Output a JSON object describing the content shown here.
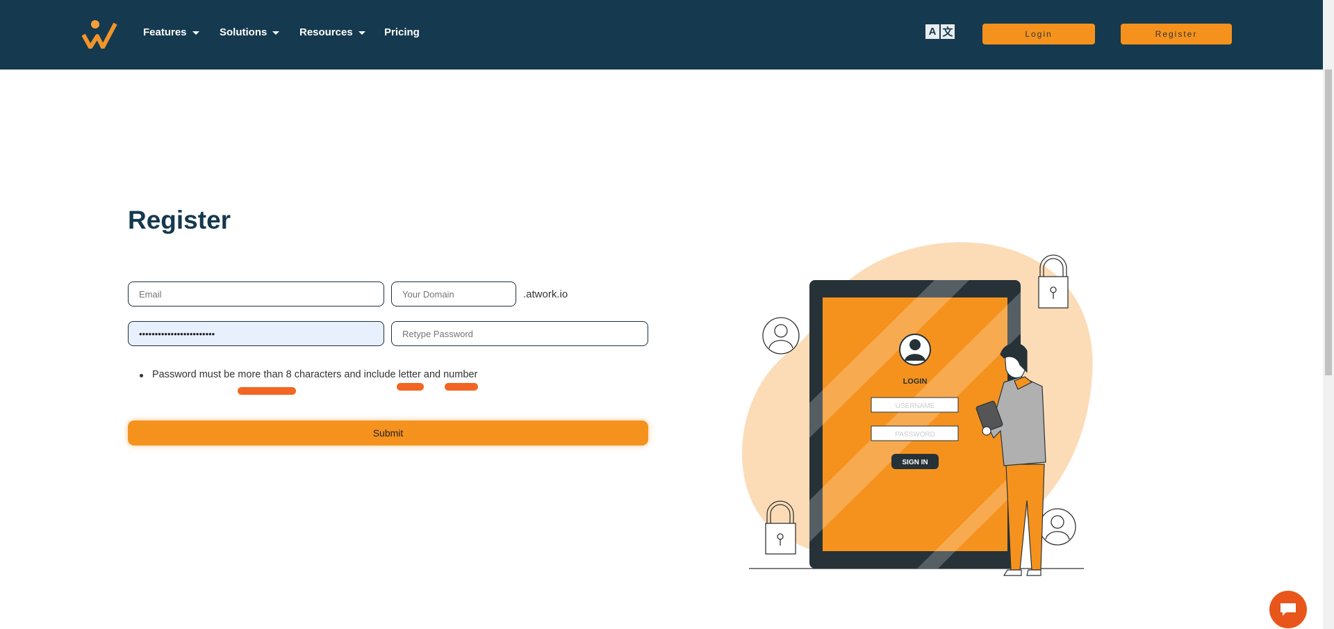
{
  "header": {
    "nav": [
      {
        "label": "Features",
        "has_dropdown": true
      },
      {
        "label": "Solutions",
        "has_dropdown": true
      },
      {
        "label": "Resources",
        "has_dropdown": true
      },
      {
        "label": "Pricing",
        "has_dropdown": false
      }
    ],
    "translate_icon": {
      "left": "A",
      "right": "文"
    },
    "login_label": "Login",
    "register_label": "Register"
  },
  "form": {
    "title": "Register",
    "email_placeholder": "Email",
    "domain_placeholder": "Your Domain",
    "domain_suffix": ".atwork.io",
    "password_value": "••••••••••••••••••••••••",
    "retype_placeholder": "Retype Password",
    "hint": "Password must be more than 8 characters and include letter and number",
    "submit_label": "Submit"
  },
  "illustration": {
    "login_title": "LOGIN",
    "username_placeholder": "USERNAME",
    "password_placeholder": "PASSWORD",
    "sign_in_label": "SIGN IN"
  },
  "colors": {
    "header": "#15394e",
    "accent": "#f5921e",
    "highlight": "#f26522"
  }
}
